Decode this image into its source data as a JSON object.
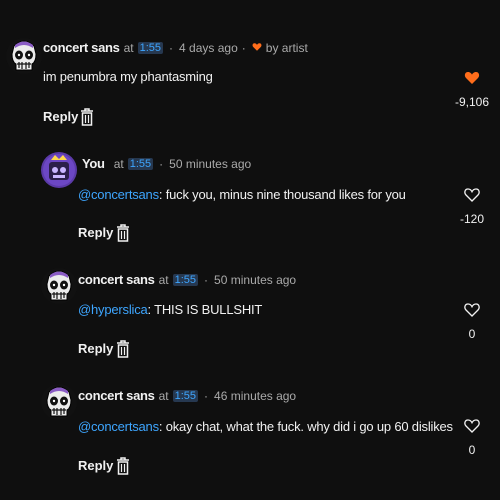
{
  "colors": {
    "background": "#0f0f0f",
    "mention": "#3ea6ff",
    "timestamp_bg": "#263850",
    "liked_heart": "#ff6d1b",
    "muted": "#aaaaaa"
  },
  "comments": [
    {
      "author": "concert sans",
      "at": "at",
      "timestamp": "1:55",
      "time": "4 days ago",
      "hearted_by_artist": true,
      "by_artist_label": "by artist",
      "mention": "",
      "text": "im penumbra my phantasming",
      "reply_label": "Reply",
      "like_count": "-9,106",
      "liked": true
    },
    {
      "author": "You",
      "at": "at",
      "timestamp": "1:55",
      "time": "50 minutes ago",
      "mention": "@concertsans",
      "text": ": fuck you, minus nine thousand likes for you",
      "reply_label": "Reply",
      "like_count": "-120",
      "liked": false
    },
    {
      "author": "concert sans",
      "at": "at",
      "timestamp": "1:55",
      "time": "50 minutes ago",
      "mention": "@hyperslica",
      "text": ": THIS IS BULLSHIT",
      "reply_label": "Reply",
      "like_count": "0",
      "liked": false
    },
    {
      "author": "concert sans",
      "at": "at",
      "timestamp": "1:55",
      "time": "46 minutes ago",
      "mention": "@concertsans",
      "text": ": okay chat, what the fuck. why did i go up 60 dislikes",
      "reply_label": "Reply",
      "like_count": "0",
      "liked": false
    }
  ],
  "separator": "·"
}
